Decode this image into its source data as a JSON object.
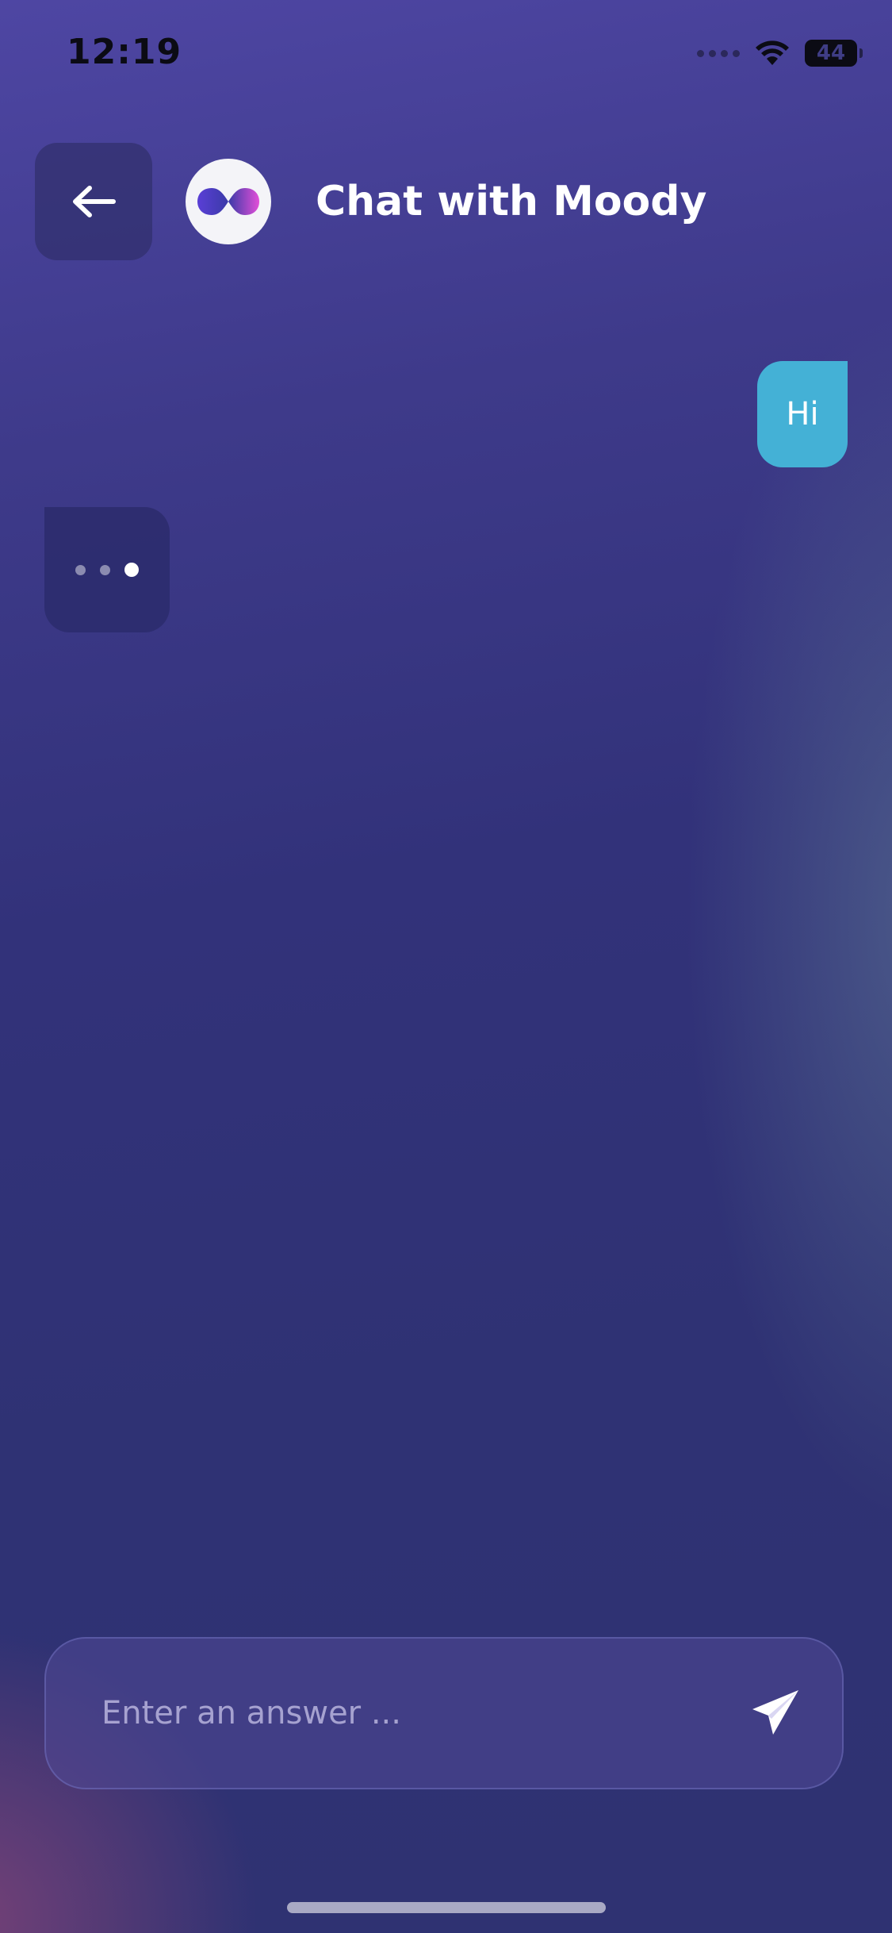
{
  "status_bar": {
    "time": "12:19",
    "battery": "44",
    "icons": [
      "signal-dots-icon",
      "wifi-icon",
      "battery-icon"
    ]
  },
  "header": {
    "back_icon": "arrow-left-icon",
    "avatar_icon": "infinity-logo-icon",
    "title": "Chat with Moody"
  },
  "messages": [
    {
      "sender": "user",
      "text": "Hi"
    },
    {
      "sender": "bot",
      "typing": true
    }
  ],
  "composer": {
    "placeholder": "Enter an answer ...",
    "value": "",
    "send_icon": "paper-plane-icon"
  },
  "colors": {
    "user_bubble": "#44b1d6",
    "background_top": "#4e46a3",
    "background_bottom": "#2f3272"
  }
}
